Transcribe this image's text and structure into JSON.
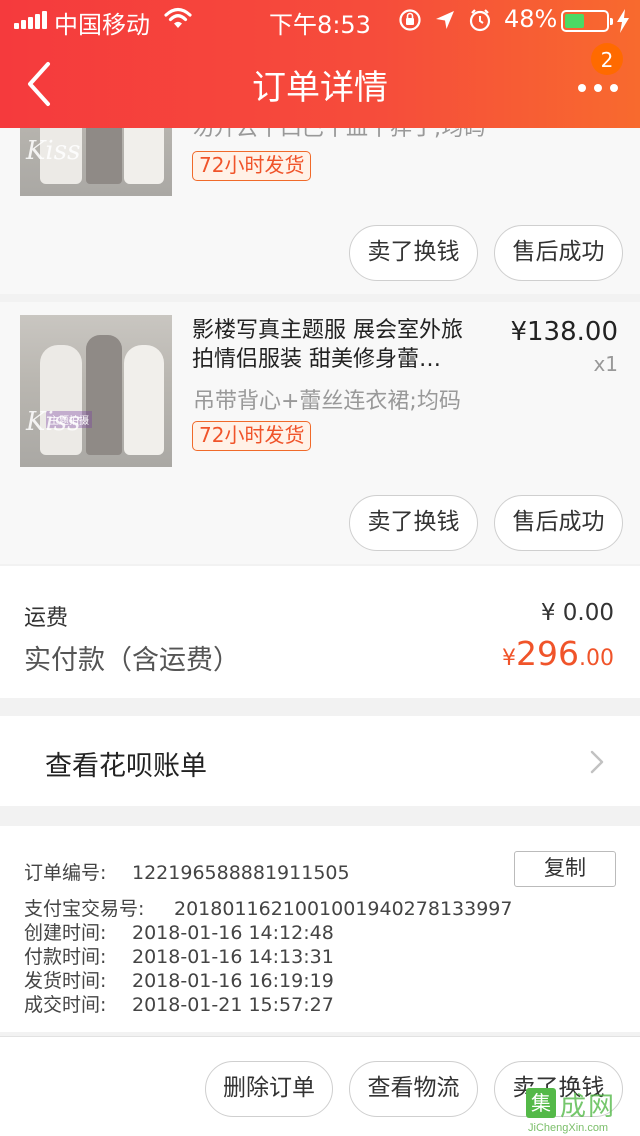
{
  "status_bar": {
    "carrier": "中国移动",
    "time": "下午8:53",
    "battery_percent": "48%",
    "battery_level": 0.48,
    "battery_color": "#4cd964"
  },
  "nav": {
    "title": "订单详情",
    "badge_count": "2",
    "back_icon": "chevron-left-icon",
    "more_icon": "more-dots-icon"
  },
  "items": [
    {
      "title_partial": "勿升云十口巴十皿十猝丁;均码",
      "shipping_tag": "72小时发货",
      "actions": [
        "卖了换钱",
        "售后成功"
      ]
    },
    {
      "title_line1": "影楼写真主题服 展会室外旅",
      "title_line2": "拍情侣服装  甜美修身蕾…",
      "price": "¥138.00",
      "quantity": "x1",
      "sku": "吊带背心+蕾丝连衣裙;均码",
      "shipping_tag": "72小时发货",
      "actions": [
        "卖了换钱",
        "售后成功"
      ]
    }
  ],
  "totals": {
    "shipping_label": "运费",
    "shipping_value": "¥ 0.00",
    "paid_label": "实付款（含运费）",
    "paid_currency": "¥",
    "paid_integer": "296",
    "paid_decimal": ".00",
    "accent_color": "#f0542a"
  },
  "huabei": {
    "label": "查看花呗账单"
  },
  "order_info": {
    "order_no_label": "订单编号:",
    "order_no": "122196588881911505",
    "copy_label": "复制",
    "alipay_label": "支付宝交易号:",
    "alipay_no": "2018011621001001940278133997",
    "created_label": "创建时间:",
    "created": "2018-01-16 14:12:48",
    "paid_time_label": "付款时间:",
    "paid_time": "2018-01-16 14:13:31",
    "shipped_label": "发货时间:",
    "shipped": "2018-01-16 16:19:19",
    "completed_label": "成交时间:",
    "completed": "2018-01-21 15:57:27"
  },
  "bottom_actions": [
    "删除订单",
    "查看物流",
    "卖了换钱"
  ],
  "watermark": {
    "box_char": "集",
    "cn": "成网",
    "en": "JiChengXin.com"
  }
}
